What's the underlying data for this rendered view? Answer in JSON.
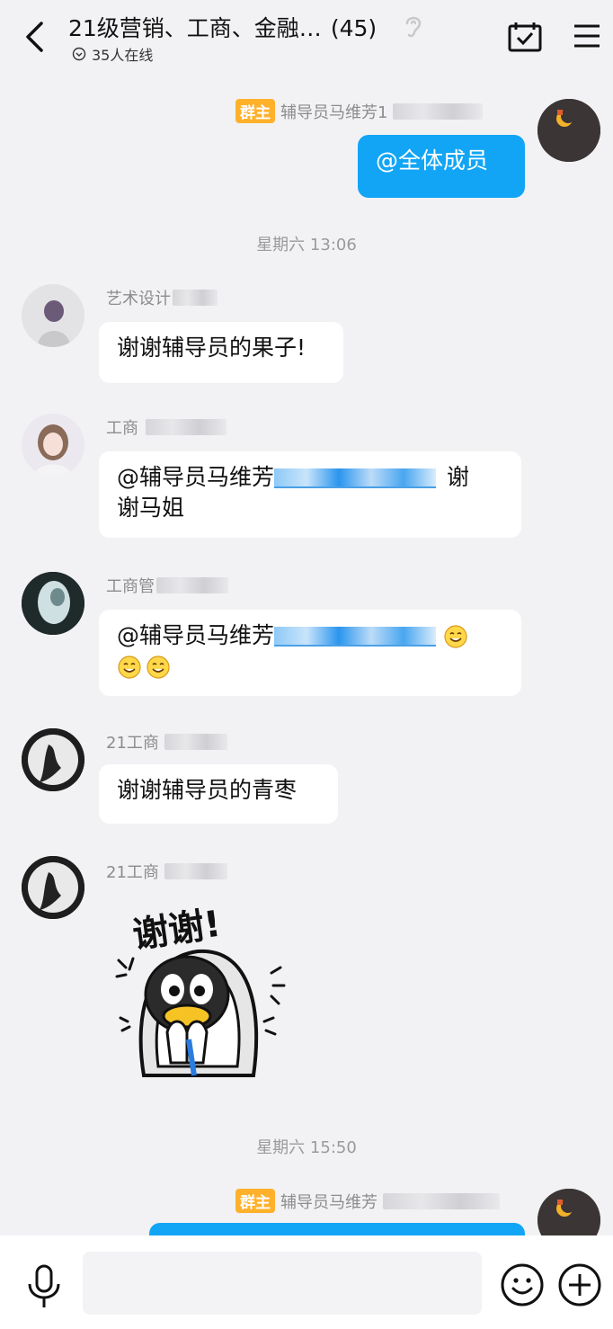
{
  "header": {
    "title": "21级营销、工商、金融…",
    "member_count": "(45)",
    "online_text": "35人在线"
  },
  "timestamps": [
    "星期六 13:06",
    "星期六 15:50"
  ],
  "messages": [
    {
      "sender": "辅导员马维芳1",
      "badge": "群主",
      "text": "@全体成员",
      "mine": true
    },
    {
      "sender": "艺术设计",
      "text": "谢谢辅导员的果子!"
    },
    {
      "sender": "工商",
      "text_prefix": "@辅导员马维芳",
      "text_suffix": "谢",
      "text_line2": "谢马姐"
    },
    {
      "sender": "工商管",
      "text_prefix": "@辅导员马维芳",
      "emoji": "grinning-face-emoji"
    },
    {
      "sender": "21工商",
      "text": "谢谢辅导员的青枣"
    },
    {
      "sender": "21工商",
      "sticker_text": "谢谢!"
    },
    {
      "sender": "辅导员马维芳",
      "badge": "群主",
      "mine": true
    }
  ],
  "input": {
    "placeholder": ""
  },
  "colors": {
    "accent": "#12a5f5",
    "badge": "#ffb12b",
    "background": "#f2f2f5"
  }
}
